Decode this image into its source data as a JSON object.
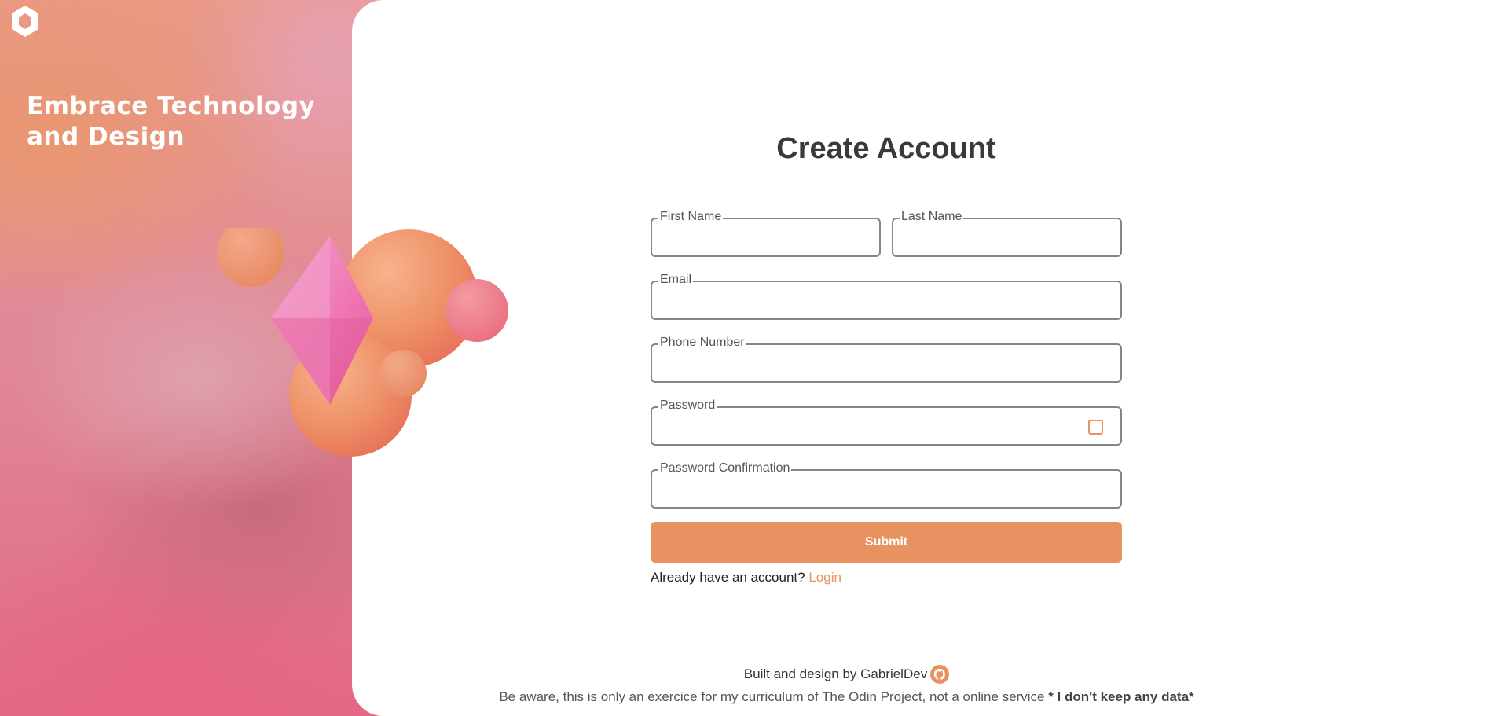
{
  "hero": {
    "headline_line1": "Embrace Technology",
    "headline_line2": "and Design",
    "logo_icon": "hexagon-ring-logo-icon",
    "illustration": "3d-spheres-and-crystal-illustration"
  },
  "form": {
    "title": "Create Account",
    "fields": {
      "first_name": {
        "label": "First Name",
        "value": ""
      },
      "last_name": {
        "label": "Last Name",
        "value": ""
      },
      "email": {
        "label": "Email",
        "value": ""
      },
      "phone": {
        "label": "Phone Number",
        "value": ""
      },
      "password": {
        "label": "Password",
        "value": ""
      },
      "password_confirmation": {
        "label": "Password Confirmation",
        "value": ""
      }
    },
    "submit_label": "Submit",
    "login_prompt": "Already have an account?",
    "login_link": "Login"
  },
  "footer": {
    "credit": "Built and design by GabrielDev",
    "github_icon": "github-icon",
    "disclaimer": "Be aware, this is only an exercice for my curriculum of The Odin Project, not a online service",
    "disclaimer_bold": "* I don't keep any data*"
  },
  "colors": {
    "accent": "#e89262",
    "title": "#3a3a3a",
    "field_border": "#858585"
  }
}
